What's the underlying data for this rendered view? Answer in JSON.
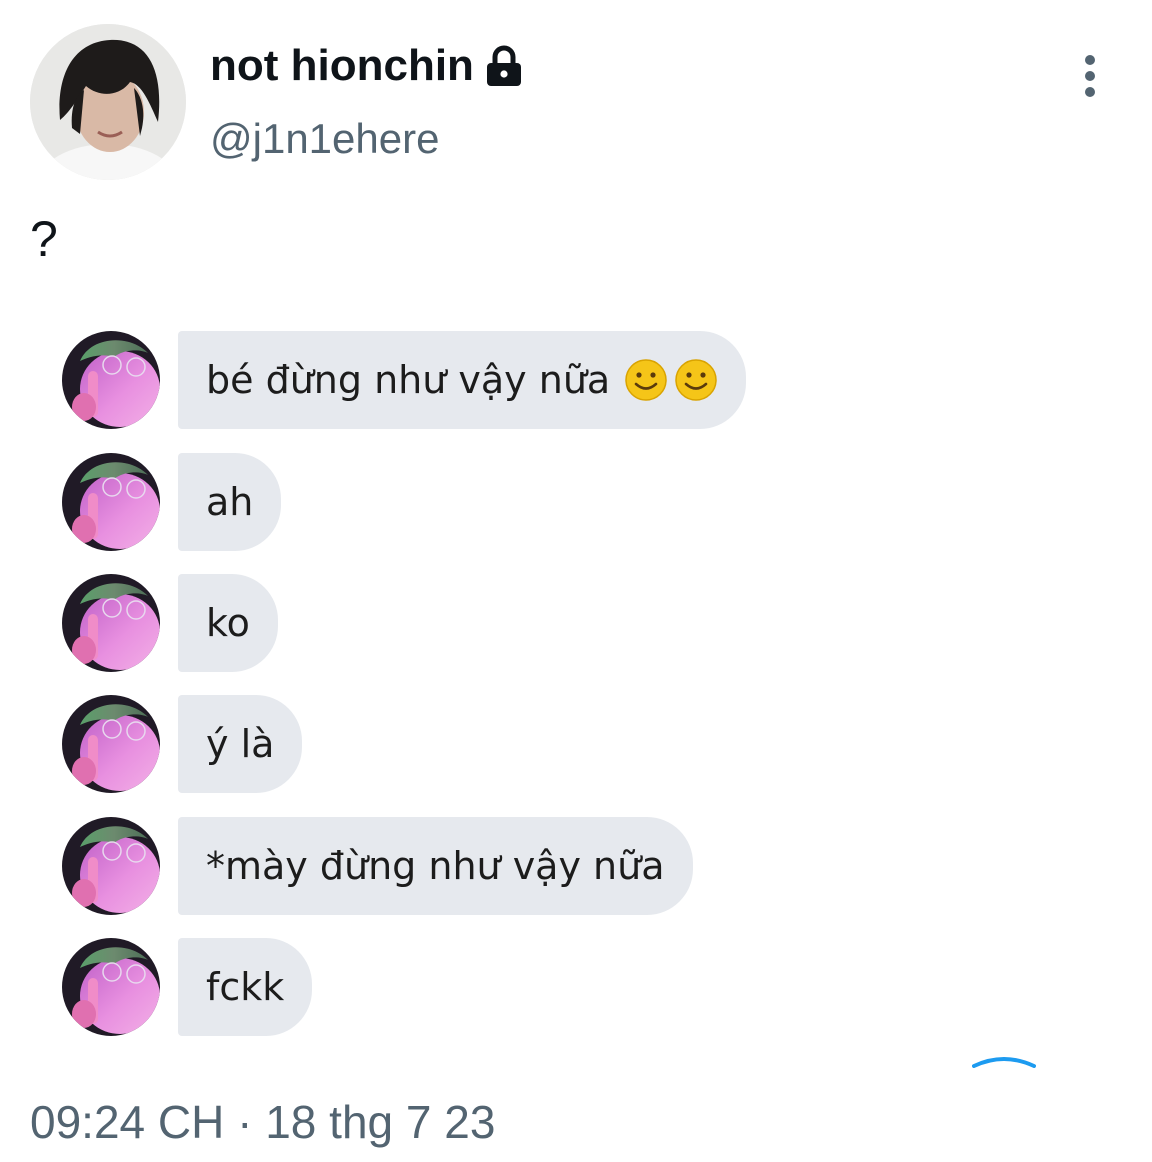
{
  "tweet": {
    "display_name": "not hionchin",
    "handle": "@j1n1ehere",
    "text": "?",
    "timestamp": "09:24 CH · 18 thg 7 23",
    "protected_icon": "lock-icon",
    "more_icon": "more-vertical-icon"
  },
  "messages": [
    {
      "text": "bé đừng như vậy nữa",
      "emoji": [
        "slightly-smiling-face-icon",
        "slightly-smiling-face-icon"
      ]
    },
    {
      "text": "ah"
    },
    {
      "text": "ko"
    },
    {
      "text": "ý là"
    },
    {
      "text": "*mày đừng như vậy nữa"
    },
    {
      "text": "fckk"
    }
  ],
  "colors": {
    "bubble": "#e6e9ee",
    "secondary_text": "#536471",
    "accent": "#1d9bf0"
  }
}
